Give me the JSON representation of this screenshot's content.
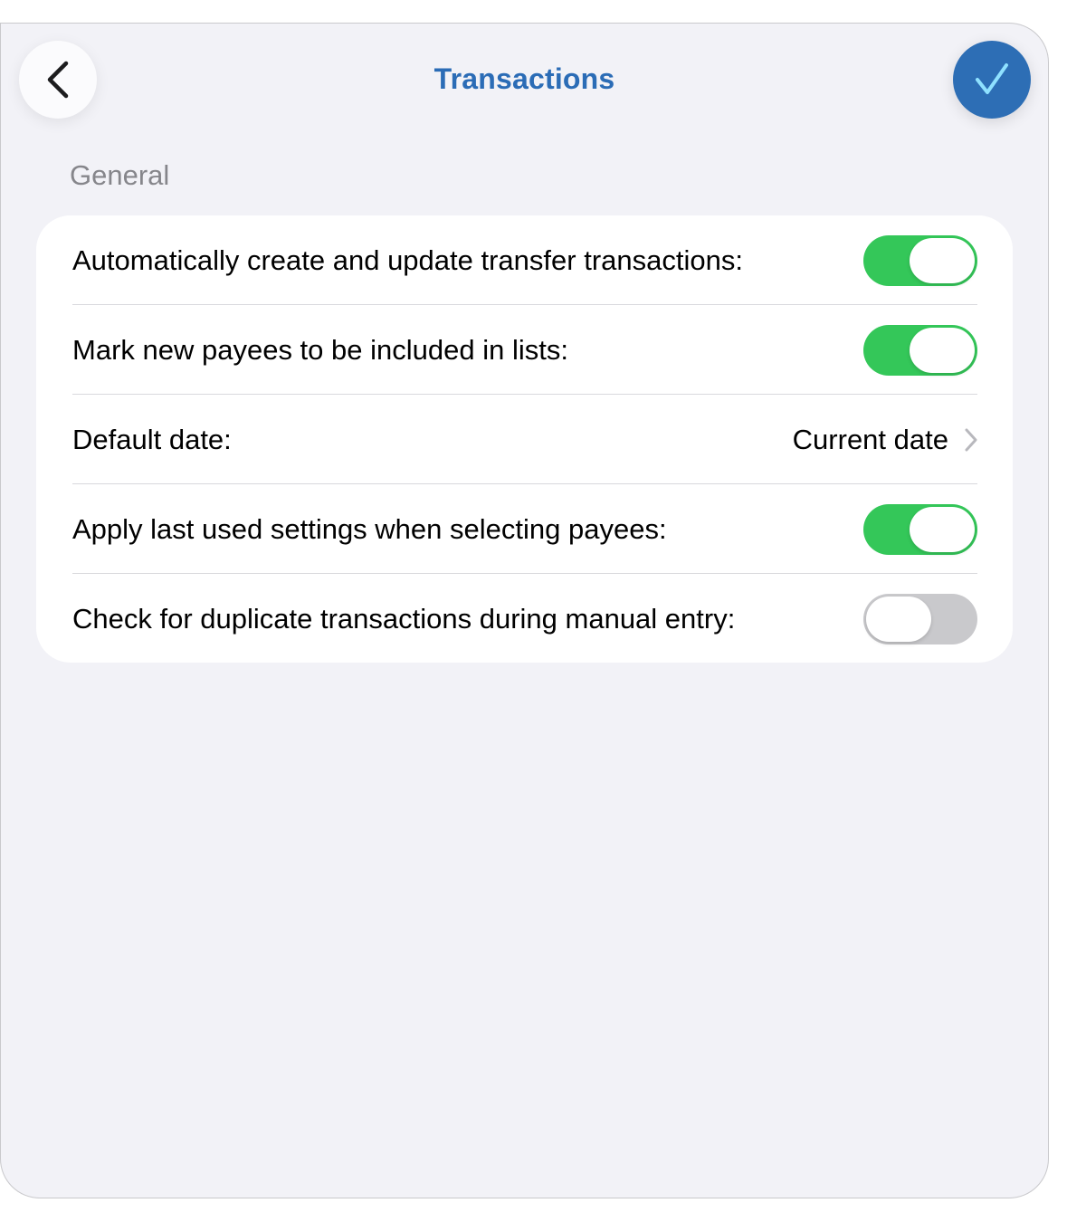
{
  "header": {
    "title": "Transactions",
    "back_icon": "chevron-left-icon",
    "done_icon": "checkmark-icon",
    "accent_color": "#2d6eb5"
  },
  "section": {
    "title": "General"
  },
  "rows": [
    {
      "label": "Automatically create and update transfer transactions:",
      "type": "toggle",
      "on": true
    },
    {
      "label": "Mark new payees to be included in lists:",
      "type": "toggle",
      "on": true
    },
    {
      "label": "Default date:",
      "type": "disclosure",
      "value": "Current date",
      "icon": "chevron-right-icon"
    },
    {
      "label": "Apply last used settings when selecting payees:",
      "type": "toggle",
      "on": true
    },
    {
      "label": "Check for duplicate transactions during manual entry:",
      "type": "toggle",
      "on": false
    }
  ],
  "colors": {
    "toggle_on": "#34c759",
    "toggle_off": "#c9c9cc",
    "background": "#f2f2f7"
  }
}
